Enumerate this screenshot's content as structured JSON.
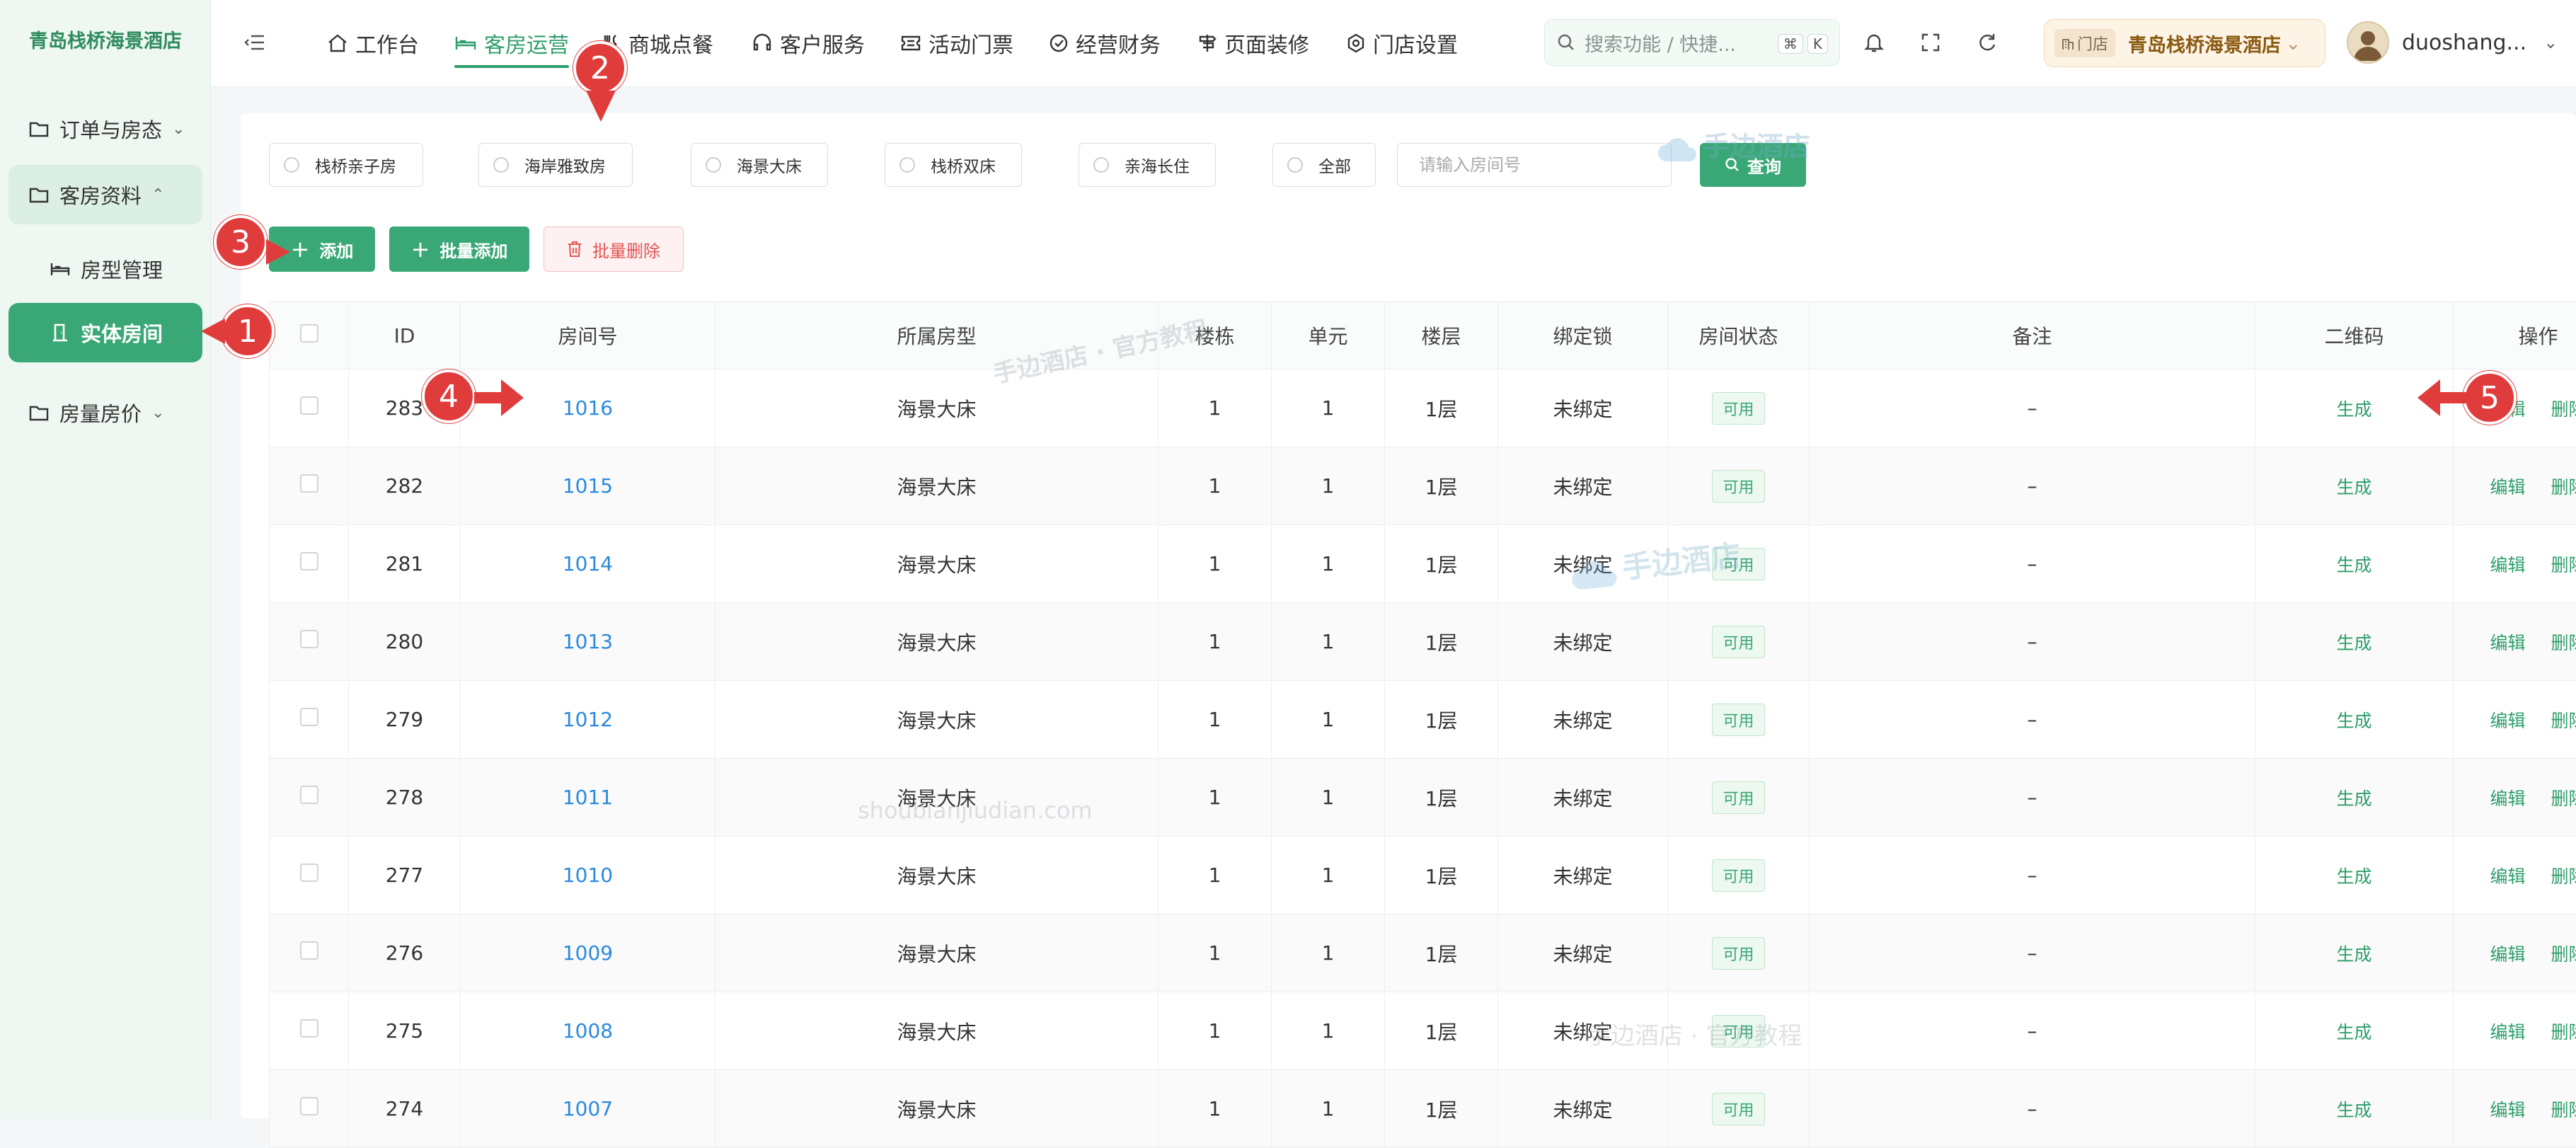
{
  "brand": "青岛栈桥海景酒店",
  "sidebar": {
    "items": [
      {
        "label": "订单与房态"
      },
      {
        "label": "客房资料"
      },
      {
        "label": "房型管理"
      },
      {
        "label": "实体房间"
      },
      {
        "label": "房量房价"
      }
    ]
  },
  "header": {
    "tabs": [
      {
        "label": "工作台"
      },
      {
        "label": "客房运营"
      },
      {
        "label": "商城点餐"
      },
      {
        "label": "客户服务"
      },
      {
        "label": "活动门票"
      },
      {
        "label": "经营财务"
      },
      {
        "label": "页面装修"
      },
      {
        "label": "门店设置"
      }
    ],
    "search_placeholder": "搜索功能 / 快捷...",
    "kbd1": "⌘",
    "kbd2": "K",
    "store_tag": "门店",
    "store_name": "青岛栈桥海景酒店",
    "user_name": "duoshang..."
  },
  "filters": {
    "room_types": [
      "栈桥亲子房",
      "海岸雅致房",
      "海景大床",
      "栈桥双床",
      "亲海长住",
      "全部"
    ],
    "room_no_placeholder": "请输入房间号",
    "query_label": "查询"
  },
  "actions": {
    "add": "添加",
    "batch_add": "批量添加",
    "batch_delete": "批量删除"
  },
  "table": {
    "headers": [
      "ID",
      "房间号",
      "所属房型",
      "楼栋",
      "单元",
      "楼层",
      "绑定锁",
      "房间状态",
      "备注",
      "二维码",
      "操作"
    ],
    "rows": [
      {
        "id": "283",
        "room": "1016",
        "type": "海景大床",
        "building": "1",
        "unit": "1",
        "floor": "1层",
        "lock": "未绑定",
        "status": "可用",
        "note": "–",
        "qr": "生成",
        "edit": "编辑",
        "del": "删除"
      },
      {
        "id": "282",
        "room": "1015",
        "type": "海景大床",
        "building": "1",
        "unit": "1",
        "floor": "1层",
        "lock": "未绑定",
        "status": "可用",
        "note": "–",
        "qr": "生成",
        "edit": "编辑",
        "del": "删除"
      },
      {
        "id": "281",
        "room": "1014",
        "type": "海景大床",
        "building": "1",
        "unit": "1",
        "floor": "1层",
        "lock": "未绑定",
        "status": "可用",
        "note": "–",
        "qr": "生成",
        "edit": "编辑",
        "del": "删除"
      },
      {
        "id": "280",
        "room": "1013",
        "type": "海景大床",
        "building": "1",
        "unit": "1",
        "floor": "1层",
        "lock": "未绑定",
        "status": "可用",
        "note": "–",
        "qr": "生成",
        "edit": "编辑",
        "del": "删除"
      },
      {
        "id": "279",
        "room": "1012",
        "type": "海景大床",
        "building": "1",
        "unit": "1",
        "floor": "1层",
        "lock": "未绑定",
        "status": "可用",
        "note": "–",
        "qr": "生成",
        "edit": "编辑",
        "del": "删除"
      },
      {
        "id": "278",
        "room": "1011",
        "type": "海景大床",
        "building": "1",
        "unit": "1",
        "floor": "1层",
        "lock": "未绑定",
        "status": "可用",
        "note": "–",
        "qr": "生成",
        "edit": "编辑",
        "del": "删除"
      },
      {
        "id": "277",
        "room": "1010",
        "type": "海景大床",
        "building": "1",
        "unit": "1",
        "floor": "1层",
        "lock": "未绑定",
        "status": "可用",
        "note": "–",
        "qr": "生成",
        "edit": "编辑",
        "del": "删除"
      },
      {
        "id": "276",
        "room": "1009",
        "type": "海景大床",
        "building": "1",
        "unit": "1",
        "floor": "1层",
        "lock": "未绑定",
        "status": "可用",
        "note": "–",
        "qr": "生成",
        "edit": "编辑",
        "del": "删除"
      },
      {
        "id": "275",
        "room": "1008",
        "type": "海景大床",
        "building": "1",
        "unit": "1",
        "floor": "1层",
        "lock": "未绑定",
        "status": "可用",
        "note": "–",
        "qr": "生成",
        "edit": "编辑",
        "del": "删除"
      },
      {
        "id": "274",
        "room": "1007",
        "type": "海景大床",
        "building": "1",
        "unit": "1",
        "floor": "1层",
        "lock": "未绑定",
        "status": "可用",
        "note": "–",
        "qr": "生成",
        "edit": "编辑",
        "del": "删除"
      }
    ]
  },
  "annotations": [
    "1",
    "2",
    "3",
    "4",
    "5"
  ],
  "watermarks": [
    "手边酒店",
    "手边酒店 · 官方教程",
    "shoubianjiudian.com"
  ],
  "colors": {
    "accent": "#3aa876",
    "link": "#2a8ae0",
    "danger": "#e55353",
    "annotation": "#e03c3c"
  }
}
